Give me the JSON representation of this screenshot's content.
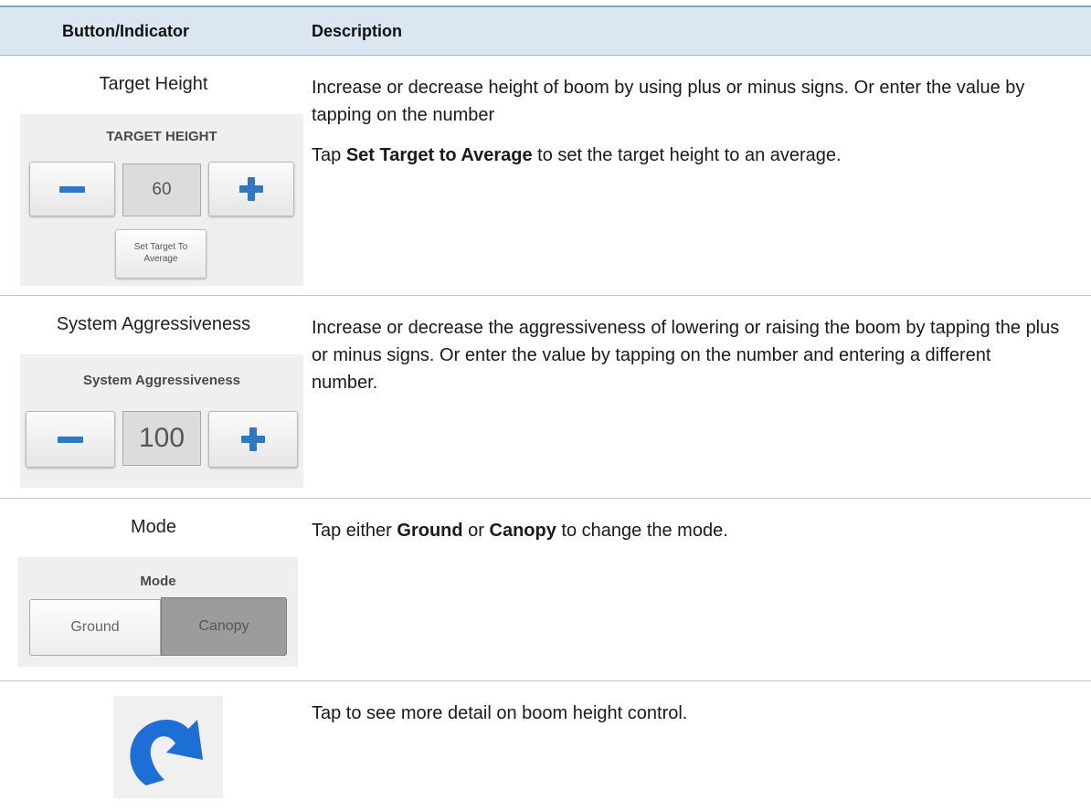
{
  "table": {
    "header": {
      "col1": "Button/Indicator",
      "col2": "Description"
    },
    "rows": [
      {
        "label": "Target Height",
        "widget": {
          "title": "TARGET HEIGHT",
          "value": "60",
          "button": "Set Target To Average"
        },
        "desc": [
          "Increase or decrease height of boom by using plus or minus signs. Or enter the value by tapping on the number",
          {
            "pre": "Tap ",
            "bold": "Set Target to Average",
            "post": " to set the target height to an average."
          }
        ]
      },
      {
        "label": "System Aggressiveness",
        "widget": {
          "title": "System Aggressiveness",
          "value": "100"
        },
        "desc": [
          "Increase or decrease the aggressiveness of lowering or raising the boom by tapping the plus or minus signs. Or enter the value by tapping on the number and entering a different number."
        ]
      },
      {
        "label": "Mode",
        "widget": {
          "title": "Mode",
          "options": [
            "Ground",
            "Canopy"
          ],
          "selected": "Canopy"
        },
        "desc": {
          "pre": "Tap either ",
          "bold1": "Ground",
          "mid": " or ",
          "bold2": "Canopy",
          "post": " to change the mode."
        }
      },
      {
        "label": "",
        "widget": {
          "icon": "redo-arrow-icon",
          "color": "#1d6fd6"
        },
        "desc": "Tap to see more detail on boom height control."
      }
    ]
  },
  "colors": {
    "header_bg": "#dbe6f0",
    "accent_blue": "#2f78c4",
    "row_border": "#c6cdd4"
  }
}
